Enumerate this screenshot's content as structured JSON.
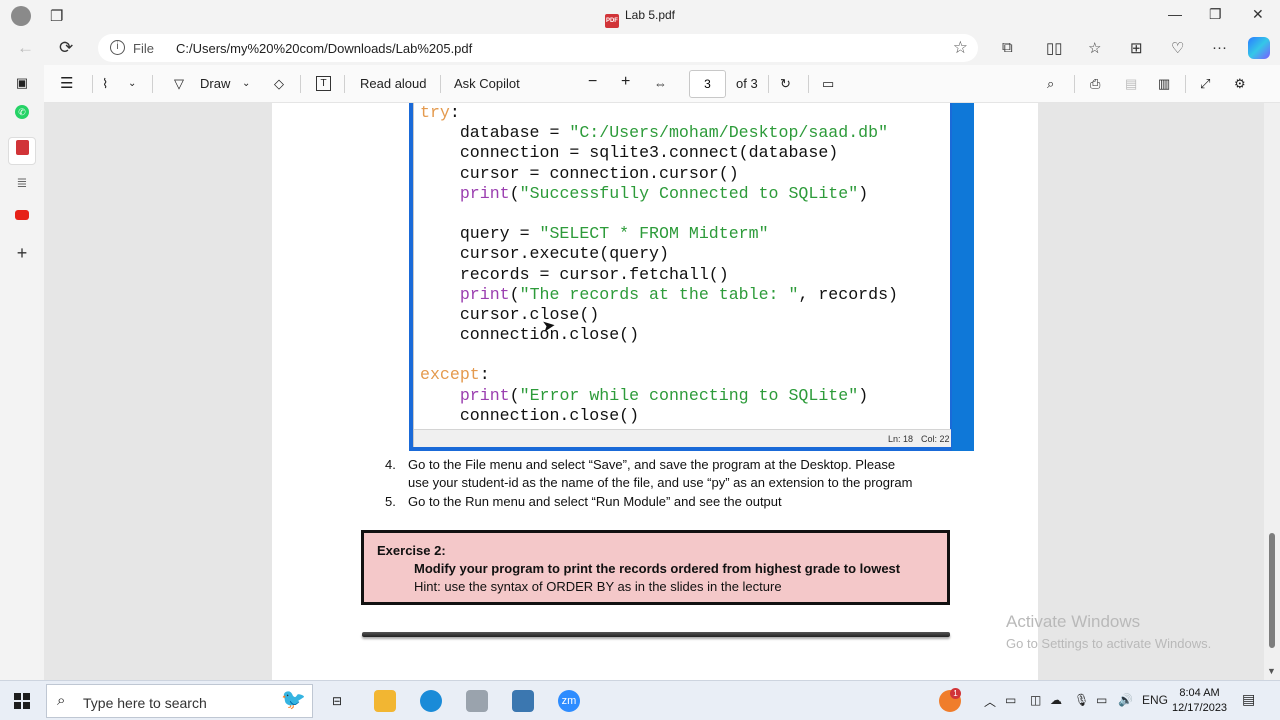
{
  "window": {
    "title": "Lab 5.pdf",
    "file_icon": "pdf-file-icon"
  },
  "address": {
    "scheme": "File",
    "url": "C:/Users/my%20%20com/Downloads/Lab%205.pdf"
  },
  "pdf_toolbar": {
    "draw_label": "Draw",
    "read_aloud_label": "Read aloud",
    "ask_copilot_label": "Ask Copilot",
    "page_current": "3",
    "page_total": "of 3"
  },
  "code": {
    "lines": [
      [
        {
          "t": "try",
          "c": "kw"
        },
        {
          "t": ":",
          "c": ""
        }
      ],
      [
        {
          "t": "    database = ",
          "c": ""
        },
        {
          "t": "\"C:/Users/moham/Desktop/saad.db\"",
          "c": "str"
        }
      ],
      [
        {
          "t": "    connection = sqlite3.connect(database)",
          "c": ""
        }
      ],
      [
        {
          "t": "    cursor = connection.cursor()",
          "c": ""
        }
      ],
      [
        {
          "t": "    ",
          "c": ""
        },
        {
          "t": "print",
          "c": "fn"
        },
        {
          "t": "(",
          "c": ""
        },
        {
          "t": "\"Successfully Connected to SQLite\"",
          "c": "str"
        },
        {
          "t": ")",
          "c": ""
        }
      ],
      [
        {
          "t": "",
          "c": ""
        }
      ],
      [
        {
          "t": "    query = ",
          "c": ""
        },
        {
          "t": "\"SELECT * FROM Midterm\"",
          "c": "str"
        }
      ],
      [
        {
          "t": "    cursor.execute(query)",
          "c": ""
        }
      ],
      [
        {
          "t": "    records = cursor.fetchall()",
          "c": ""
        }
      ],
      [
        {
          "t": "    ",
          "c": ""
        },
        {
          "t": "print",
          "c": "fn"
        },
        {
          "t": "(",
          "c": ""
        },
        {
          "t": "\"The records at the table: \"",
          "c": "str"
        },
        {
          "t": ", records)",
          "c": ""
        }
      ],
      [
        {
          "t": "    cursor.close()",
          "c": ""
        }
      ],
      [
        {
          "t": "    connection.close()",
          "c": ""
        }
      ],
      [
        {
          "t": "",
          "c": ""
        }
      ],
      [
        {
          "t": "except",
          "c": "kw"
        },
        {
          "t": ":",
          "c": ""
        }
      ],
      [
        {
          "t": "    ",
          "c": ""
        },
        {
          "t": "print",
          "c": "fn"
        },
        {
          "t": "(",
          "c": ""
        },
        {
          "t": "\"Error while connecting to SQLite\"",
          "c": "str"
        },
        {
          "t": ")",
          "c": ""
        }
      ],
      [
        {
          "t": "    connection.close()",
          "c": ""
        }
      ]
    ],
    "status_ln": "Ln: 18",
    "status_col": "Col: 22"
  },
  "steps": [
    {
      "num": "4.",
      "line1": "Go to the  File  menu and select “Save”, and save the program at the Desktop. Please",
      "line2": "use your student-id as the name of the file, and use “py” as an extension to the program"
    },
    {
      "num": "5.",
      "line1": "Go to the  Run  menu and select “Run Module” and see the output",
      "line2": ""
    }
  ],
  "exercise": {
    "heading": "Exercise 2:",
    "task": "Modify your program to print the records ordered from highest grade to lowest",
    "hint": "Hint: use the syntax of   ORDER BY   as in the slides in the lecture"
  },
  "watermark": {
    "line1": "Activate Windows",
    "line2": "Go to Settings to activate Windows."
  },
  "taskbar": {
    "search_placeholder": "Type here to search",
    "zoom_label": "zm",
    "notification_count": "1",
    "language": "ENG",
    "time": "8:04 AM",
    "date": "12/17/2023"
  },
  "colors": {
    "exercise_bg": "#f4c8c9",
    "code_keyword": "#e49a4e",
    "code_string": "#2d9b3a",
    "code_builtin": "#9b3fb0",
    "idle_blue": "#1a6ad8"
  }
}
